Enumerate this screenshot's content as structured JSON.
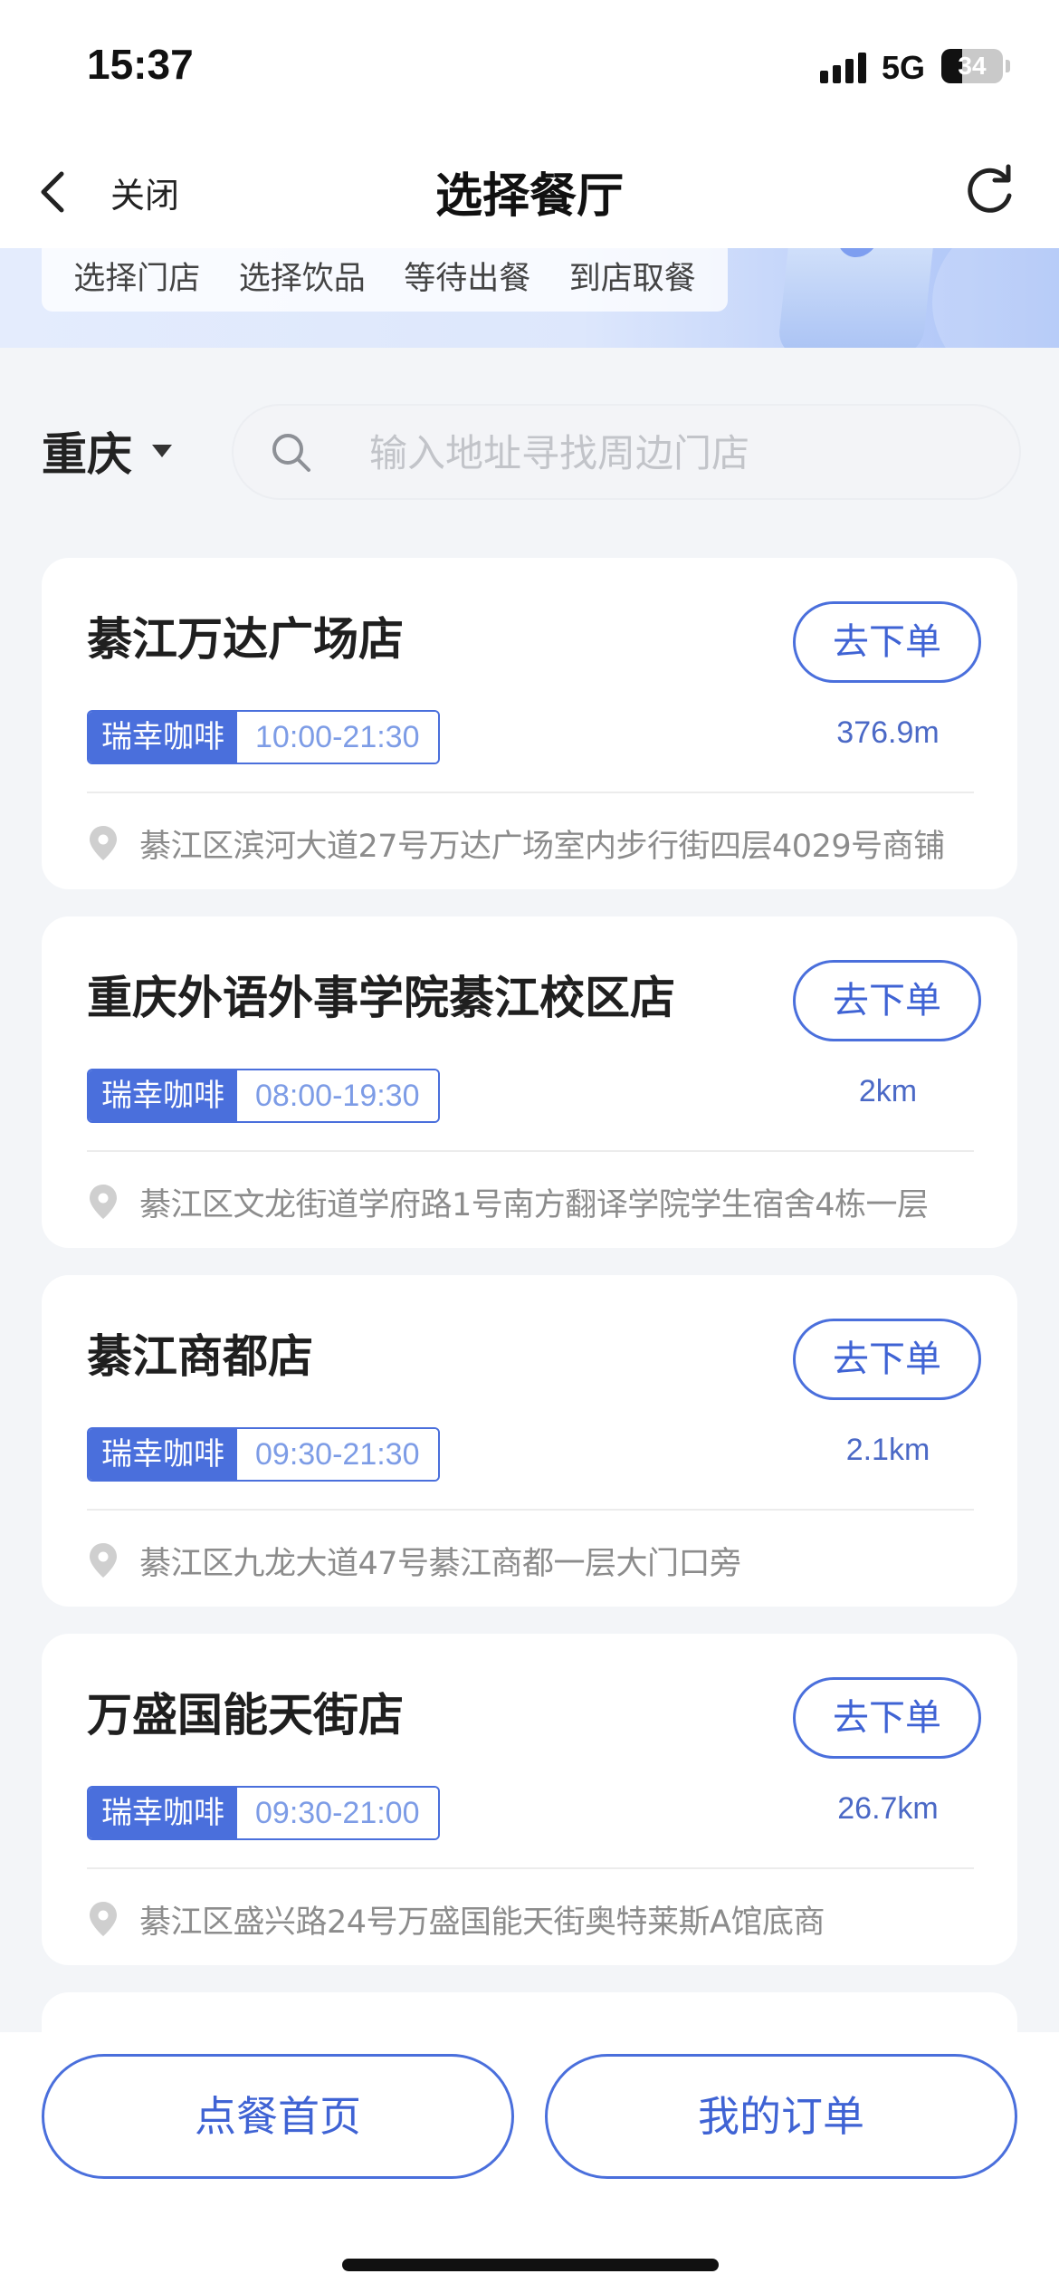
{
  "status_bar": {
    "time": "15:37",
    "network": "5G",
    "battery": "34",
    "battery_level": 0.34
  },
  "nav": {
    "back_label": "关闭",
    "title": "选择餐厅",
    "back_icon": "chevron-left-icon",
    "refresh_icon": "refresh-icon"
  },
  "banner": {
    "steps": [
      "选择门店",
      "选择饮品",
      "等待出餐",
      "到店取餐"
    ]
  },
  "location": {
    "city": "重庆"
  },
  "search": {
    "placeholder": "输入地址寻找周边门店",
    "value": ""
  },
  "stores": [
    {
      "name": "綦江万达广场店",
      "brand": "瑞幸咖啡",
      "hours": "10:00-21:30",
      "distance": "376.9m",
      "address": "綦江区滨河大道27号万达广场室内步行街四层4029号商铺",
      "order_label": "去下单"
    },
    {
      "name": "重庆外语外事学院綦江校区店",
      "brand": "瑞幸咖啡",
      "hours": "08:00-19:30",
      "distance": "2km",
      "address": "綦江区文龙街道学府路1号南方翻译学院学生宿舍4栋一层",
      "order_label": "去下单"
    },
    {
      "name": "綦江商都店",
      "brand": "瑞幸咖啡",
      "hours": "09:30-21:30",
      "distance": "2.1km",
      "address": "綦江区九龙大道47号綦江商都一层大门口旁",
      "order_label": "去下单"
    },
    {
      "name": "万盛国能天街店",
      "brand": "瑞幸咖啡",
      "hours": "09:30-21:00",
      "distance": "26.7km",
      "address": "綦江区盛兴路24号万盛国能天街奥特莱斯A馆底商",
      "order_label": "去下单"
    }
  ],
  "bottom": {
    "home_label": "点餐首页",
    "orders_label": "我的订单"
  },
  "colors": {
    "accent": "#4a6fdc",
    "tag_hours_text": "#7d9ce6",
    "background": "#f3f5f8"
  }
}
